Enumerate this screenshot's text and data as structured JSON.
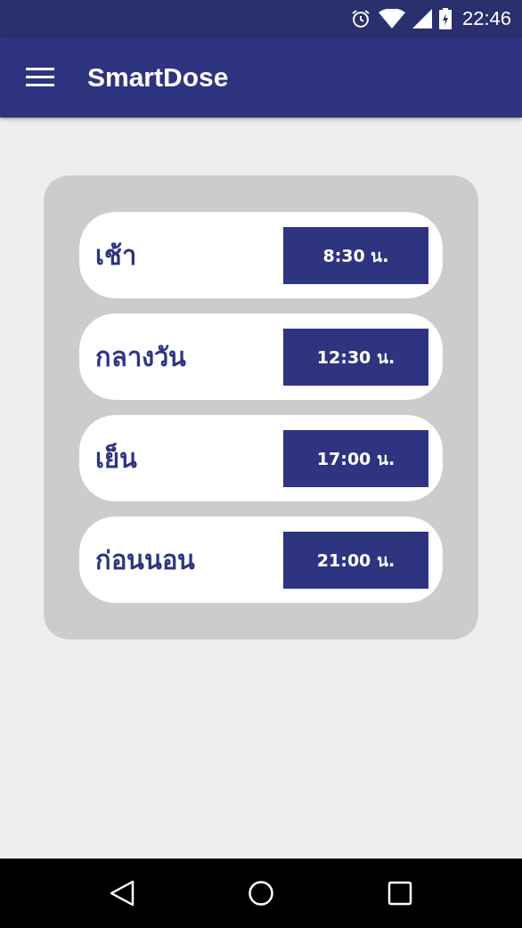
{
  "status_bar": {
    "time": "22:46"
  },
  "app_bar": {
    "title": "SmartDose"
  },
  "schedule": [
    {
      "label": "เช้า",
      "time": "8:30 น."
    },
    {
      "label": "กลางวัน",
      "time": "12:30 น."
    },
    {
      "label": "เย็น",
      "time": "17:00 น."
    },
    {
      "label": "ก่อนนอน",
      "time": "21:00 น."
    }
  ]
}
